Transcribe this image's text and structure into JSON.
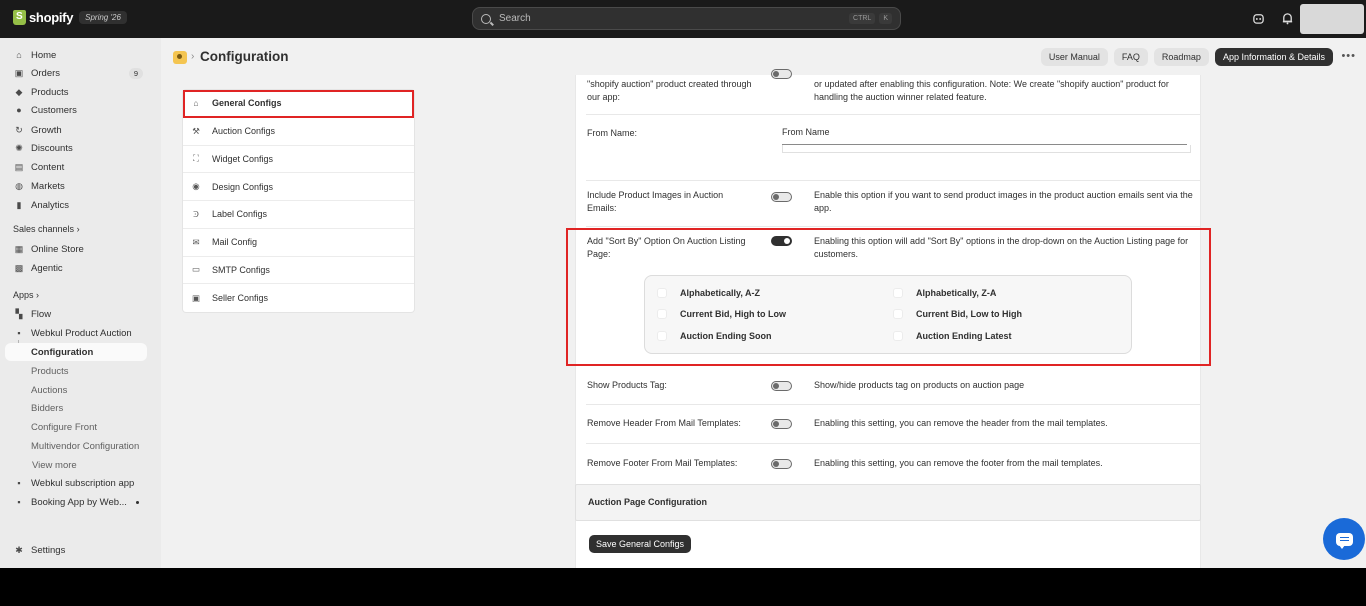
{
  "topbar": {
    "brand": "shopify",
    "edition": "Spring '26",
    "search_placeholder": "Search",
    "shortcut_ctrl": "CTRL",
    "shortcut_key": "K"
  },
  "sidebar": {
    "home": "Home",
    "orders": "Orders",
    "orders_badge": "9",
    "products": "Products",
    "customers": "Customers",
    "growth": "Growth",
    "discounts": "Discounts",
    "content": "Content",
    "markets": "Markets",
    "analytics": "Analytics",
    "sales_channels": "Sales channels",
    "online_store": "Online Store",
    "agentic": "Agentic",
    "apps": "Apps",
    "flow": "Flow",
    "webkul_auction": "Webkul Product Auction",
    "configuration": "Configuration",
    "sub_products": "Products",
    "auctions": "Auctions",
    "bidders": "Bidders",
    "configure_front": "Configure Front",
    "multivendor": "Multivendor Configuration",
    "view_more": "View more",
    "subscription_app": "Webkul subscription app",
    "booking_app": "Booking App by Web...",
    "settings": "Settings"
  },
  "header": {
    "title": "Configuration",
    "buttons": {
      "user_manual": "User Manual",
      "faq": "FAQ",
      "roadmap": "Roadmap",
      "app_info": "App Information & Details"
    }
  },
  "config_nav": {
    "general": "General Configs",
    "auction": "Auction Configs",
    "widget": "Widget Configs",
    "design": "Design Configs",
    "label": "Label Configs",
    "mail": "Mail Config",
    "smtp": "SMTP Configs",
    "seller": "Seller Configs"
  },
  "form": {
    "top_label": "\"shopify auction\" product created through our app:",
    "top_desc": "or updated after enabling this configuration. Note: We create \"shopify auction\" product for handling the auction winner related feature.",
    "from_name_label": "From Name:",
    "from_name_value": "From Name",
    "include_images_label": "Include Product Images in Auction Emails:",
    "include_images_desc": "Enable this option if you want to send product images in the product auction emails sent via the app.",
    "sort_by_label": "Add \"Sort By\" Option On Auction Listing Page:",
    "sort_by_desc": "Enabling this option will add \"Sort By\" options in the drop-down on the Auction Listing page for customers.",
    "sort_options": {
      "a_z": "Alphabetically, A-Z",
      "z_a": "Alphabetically, Z-A",
      "bid_high_low": "Current Bid, High to Low",
      "bid_low_high": "Current Bid, Low to High",
      "ending_soon": "Auction Ending Soon",
      "ending_latest": "Auction Ending Latest"
    },
    "show_tag_label": "Show Products Tag:",
    "show_tag_desc": "Show/hide products tag on products on auction page",
    "remove_header_label": "Remove Header From Mail Templates:",
    "remove_header_desc": "Enabling this setting, you can remove the header from the mail templates.",
    "remove_footer_label": "Remove Footer From Mail Templates:",
    "remove_footer_desc": "Enabling this setting, you can remove the footer from the mail templates.",
    "auction_page_section": "Auction Page Configuration",
    "save_button": "Save General Configs"
  }
}
